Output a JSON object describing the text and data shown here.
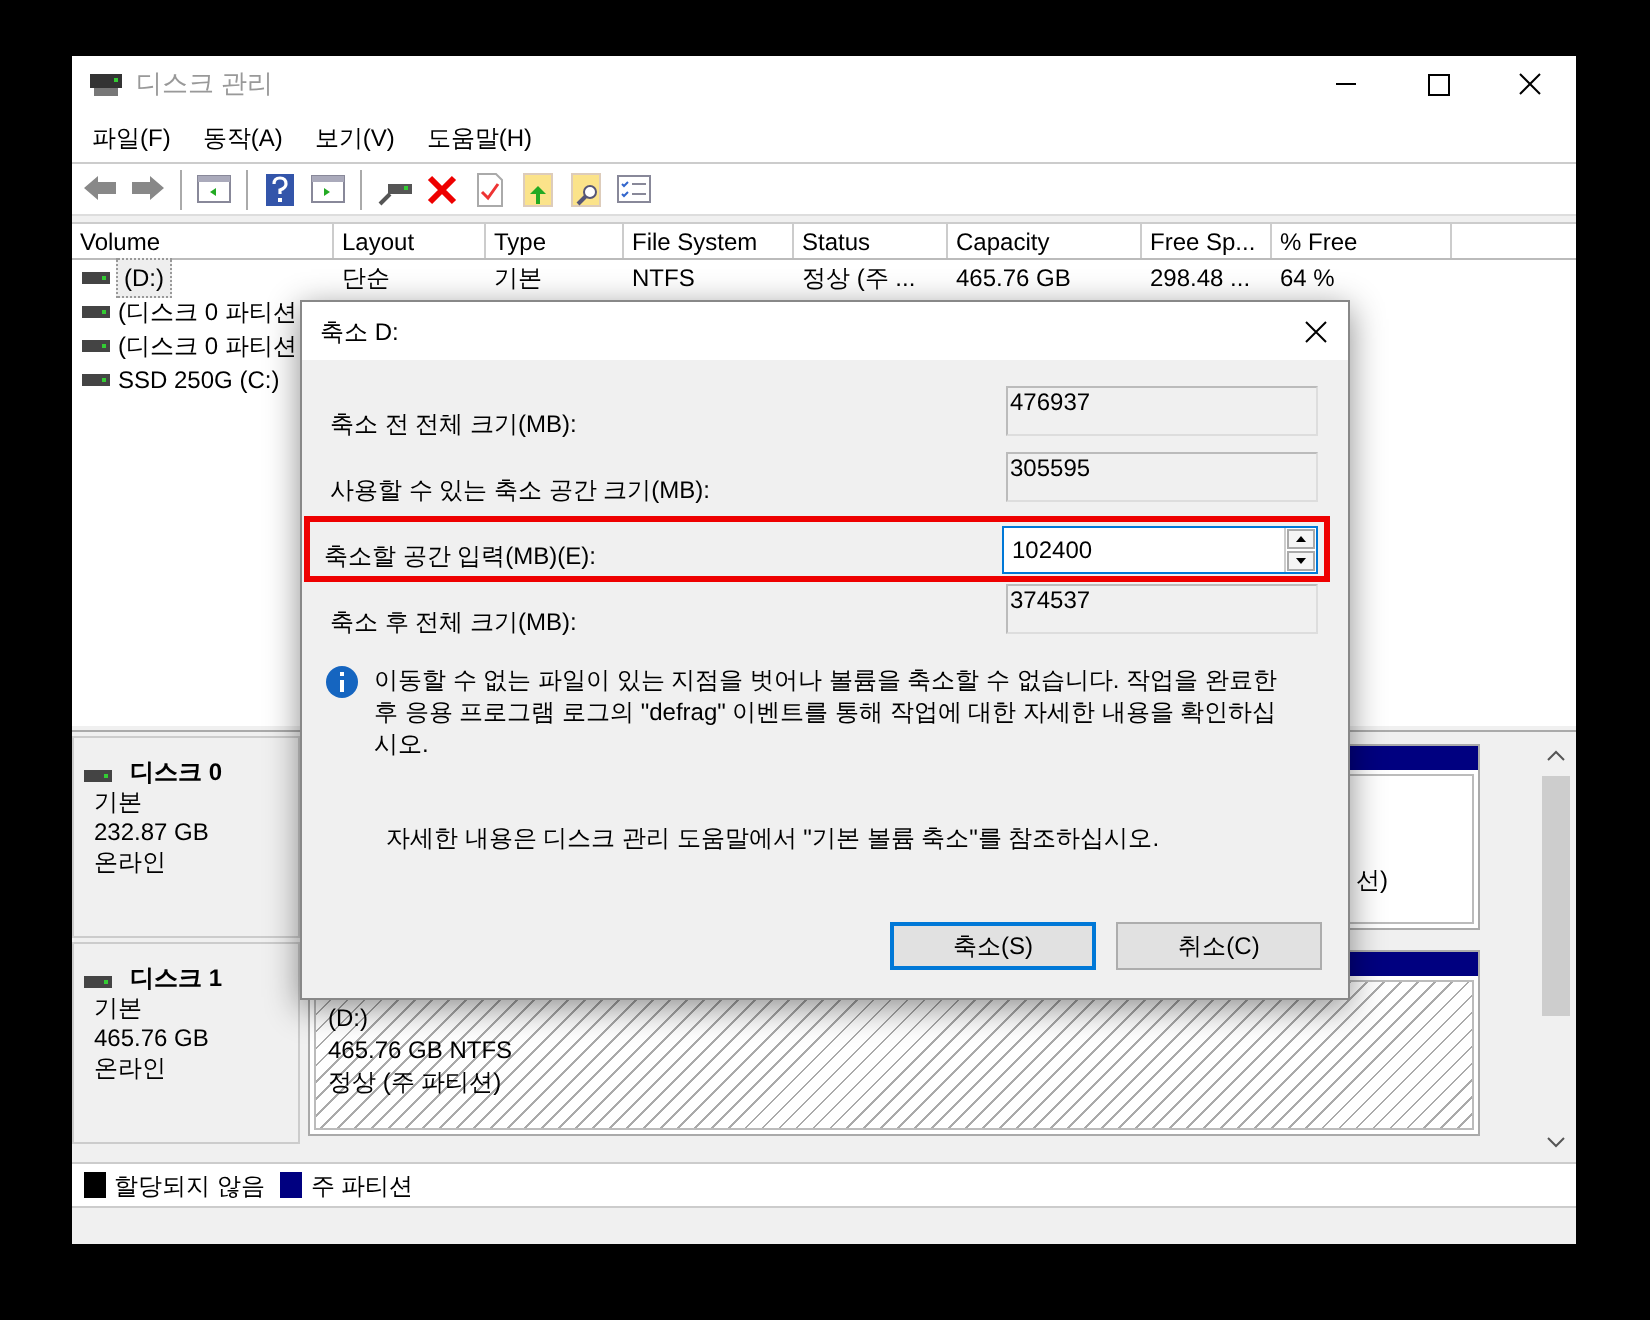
{
  "window": {
    "title": "디스크 관리"
  },
  "menu": [
    "파일(F)",
    "동작(A)",
    "보기(V)",
    "도움말(H)"
  ],
  "toolbar": [
    {
      "kind": "back"
    },
    {
      "kind": "forward"
    },
    {
      "kind": "separator"
    },
    {
      "kind": "console"
    },
    {
      "kind": "separator"
    },
    {
      "kind": "help"
    },
    {
      "kind": "panel"
    },
    {
      "kind": "separator"
    },
    {
      "kind": "connect"
    },
    {
      "kind": "delete"
    },
    {
      "kind": "check"
    },
    {
      "kind": "up"
    },
    {
      "kind": "search"
    },
    {
      "kind": "list"
    }
  ],
  "volume_table": {
    "columns": [
      "Volume",
      "Layout",
      "Type",
      "File System",
      "Status",
      "Capacity",
      "Free Sp...",
      "% Free"
    ],
    "rows": [
      {
        "cells": [
          "(D:)",
          "단순",
          "기본",
          "NTFS",
          "정상 (주 ...",
          "465.76 GB",
          "298.48 ...",
          "64 %"
        ],
        "selected": true
      },
      {
        "cells": [
          "(디스크 0 파티션"
        ],
        "selected": false
      },
      {
        "cells": [
          "(디스크 0 파티션"
        ],
        "selected": false
      },
      {
        "cells": [
          "SSD 250G (C:)"
        ],
        "selected": false
      }
    ]
  },
  "disks": [
    {
      "name": "디스크 0",
      "type": "기본",
      "size": "232.87 GB",
      "state": "온라인",
      "partition": {
        "lines": [
          "선)"
        ],
        "selected": false
      }
    },
    {
      "name": "디스크 1",
      "type": "기본",
      "size": "465.76 GB",
      "state": "온라인",
      "partition": {
        "lines": [
          "(D:)",
          "465.76 GB NTFS",
          "정상 (주 파티션)"
        ],
        "selected": true
      }
    }
  ],
  "legend": [
    {
      "label": "할당되지 않음",
      "color": "#000000"
    },
    {
      "label": "주 파티션",
      "color": "#000080"
    }
  ],
  "dialog": {
    "title": "축소 D:",
    "fields": [
      {
        "label": "축소 전 전체 크기(MB):",
        "value": "476937",
        "kind": "readonly",
        "highlighted": false
      },
      {
        "label": "사용할 수 있는 축소 공간 크기(MB):",
        "value": "305595",
        "kind": "readonly",
        "highlighted": false
      },
      {
        "label": "축소할 공간 입력(MB)(E):",
        "value": "102400",
        "kind": "spin",
        "highlighted": true
      },
      {
        "label": "축소 후 전체 크기(MB):",
        "value": "374537",
        "kind": "readonly",
        "highlighted": false
      }
    ],
    "info": "이동할 수 없는 파일이 있는 지점을 벗어나 볼륨을 축소할 수 없습니다. 작업을 완료한 후 응용 프로그램 로그의 \"defrag\" 이벤트를 통해 작업에 대한 자세한 내용을 확인하십시오.",
    "help": "자세한 내용은 디스크 관리 도움말에서 \"기본 볼륨 축소\"를 참조하십시오.",
    "buttons": [
      {
        "label": "축소(S)",
        "default": true
      },
      {
        "label": "취소(C)",
        "default": false
      }
    ]
  }
}
